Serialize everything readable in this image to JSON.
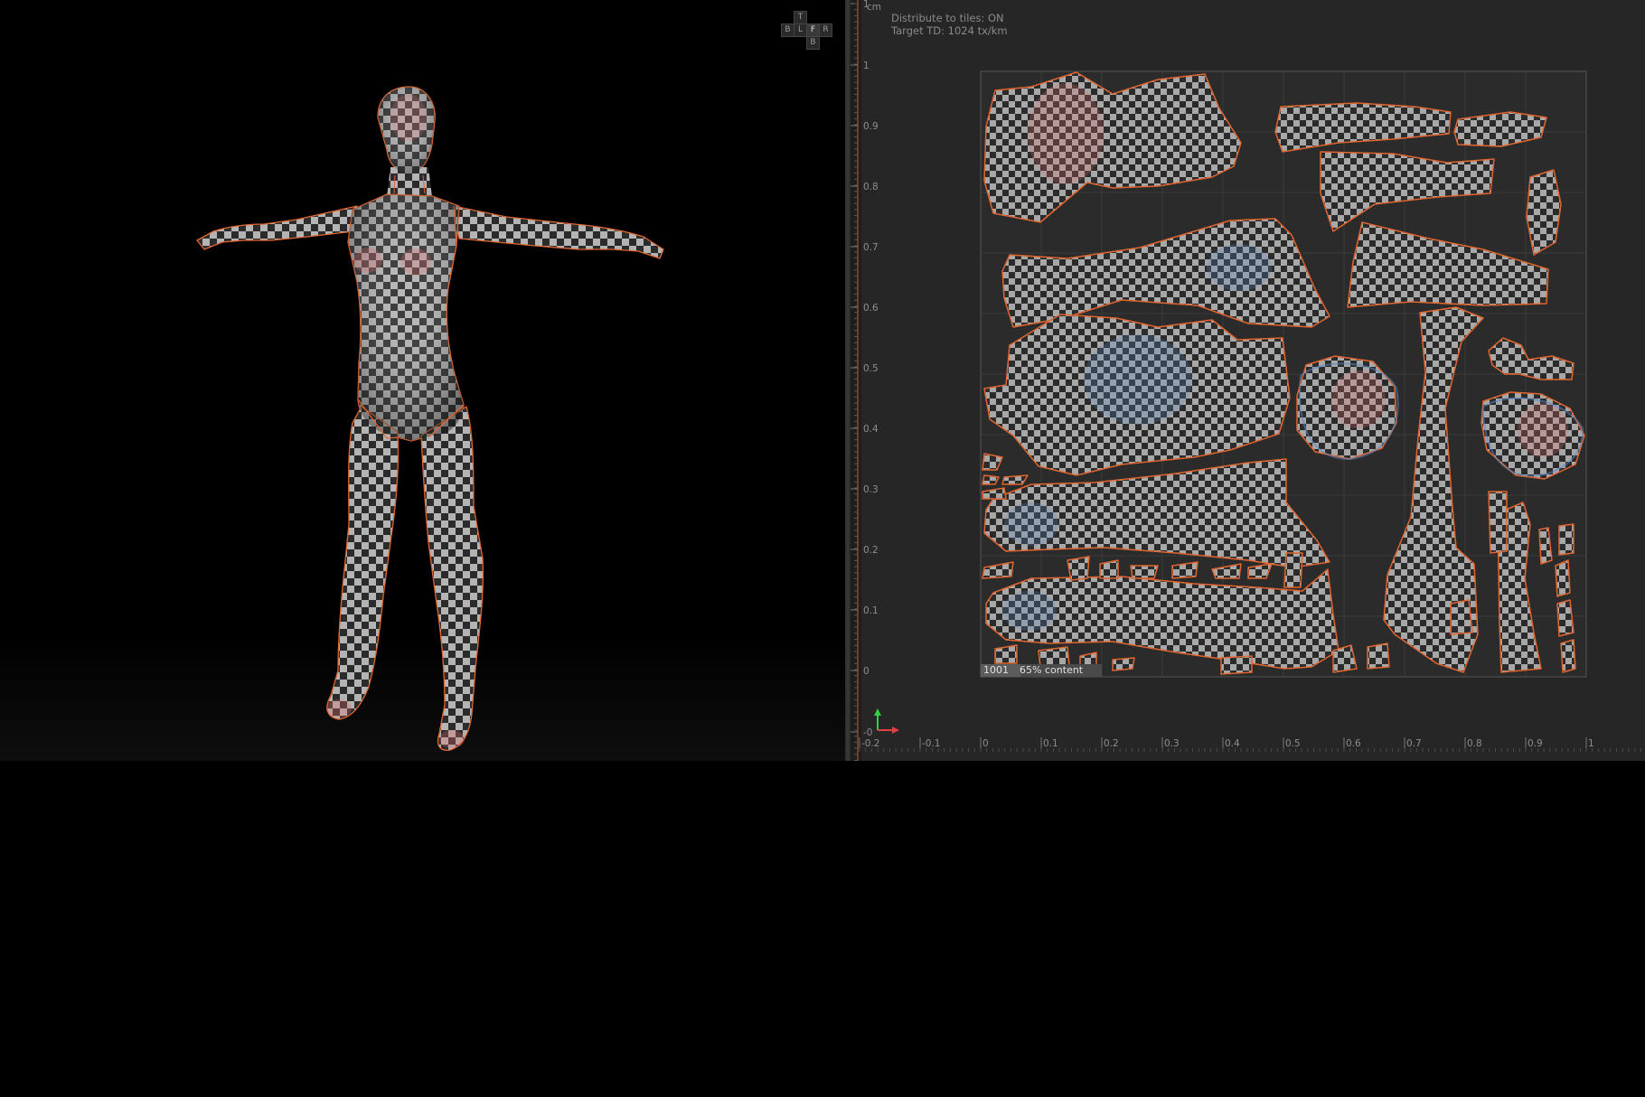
{
  "view_cube": {
    "top": "T",
    "back": "B",
    "left": "L",
    "front": "F",
    "right": "R",
    "bottom": "B"
  },
  "uv_overlay": {
    "unit": "cm",
    "distribute_label": "Distribute to tiles: ON",
    "target_td_label": "Target TD: 1024 tx/km",
    "tile_id": "1001",
    "content_pct": "65%",
    "content_label": "content"
  },
  "vertical_ruler": [
    "1",
    "1",
    "0.9",
    "0.8",
    "0.7",
    "0.6",
    "0.5",
    "0.4",
    "0.3",
    "0.2",
    "0.1",
    "0",
    "-0"
  ],
  "horizontal_ruler": [
    "-0.2",
    "-0.1",
    "0",
    "0.1",
    "0.2",
    "0.3",
    "0.4",
    "0.5",
    "0.6",
    "0.7",
    "0.8",
    "0.9",
    "1"
  ],
  "colors": {
    "seam": "#e0652f",
    "checker_light": "#a8a8a8",
    "checker_dark": "#2b2b2b",
    "uv_background": "#262626",
    "viewport_background": "#000000",
    "axis_x": "#e04040",
    "axis_y": "#30d040"
  },
  "icons": {
    "uv_axis": "uv-axis-gizmo-icon"
  }
}
